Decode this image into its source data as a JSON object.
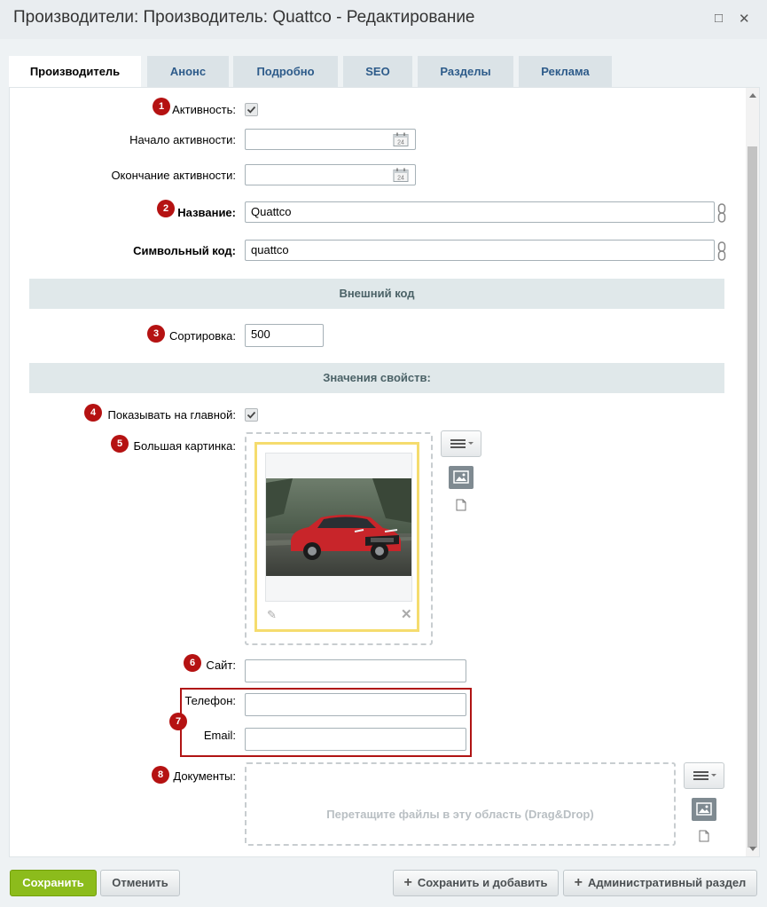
{
  "window": {
    "title": "Производители: Производитель: Quattco - Редактирование"
  },
  "tabs": [
    {
      "label": "Производитель"
    },
    {
      "label": "Анонс"
    },
    {
      "label": "Подробно"
    },
    {
      "label": "SEO"
    },
    {
      "label": "Разделы"
    },
    {
      "label": "Реклама"
    }
  ],
  "active_tab": "Производитель",
  "badges": [
    "1",
    "2",
    "3",
    "4",
    "5",
    "6",
    "7",
    "8"
  ],
  "form": {
    "active": {
      "label": "Активность:",
      "checked": true
    },
    "active_from": {
      "label": "Начало активности:",
      "value": ""
    },
    "active_to": {
      "label": "Окончание активности:",
      "value": ""
    },
    "name": {
      "label": "Название:",
      "value": "Quattco"
    },
    "code": {
      "label": "Символьный код:",
      "value": "quattco"
    },
    "external_code_section": "Внешний код",
    "sort": {
      "label": "Сортировка:",
      "value": "500"
    },
    "properties_section": "Значения свойств:",
    "show_on_main": {
      "label": "Показывать на главной:",
      "checked": true
    },
    "big_picture": {
      "label": "Большая картинка:"
    },
    "site": {
      "label": "Сайт:",
      "value": ""
    },
    "phone": {
      "label": "Телефон:",
      "value": ""
    },
    "email": {
      "label": "Email:",
      "value": ""
    },
    "documents": {
      "label": "Документы:",
      "dropzone": "Перетащите файлы в эту область (Drag&Drop)"
    }
  },
  "calendar_day": "24",
  "buttons": {
    "save": "Сохранить",
    "cancel": "Отменить",
    "save_and_add": "Сохранить и добавить",
    "admin_section": "Административный раздел"
  },
  "colors": {
    "badge": "#b51212",
    "save_button": "#8cbc1c",
    "tab_link": "#2d5b8a",
    "image_frame": "#f5dc6e"
  }
}
